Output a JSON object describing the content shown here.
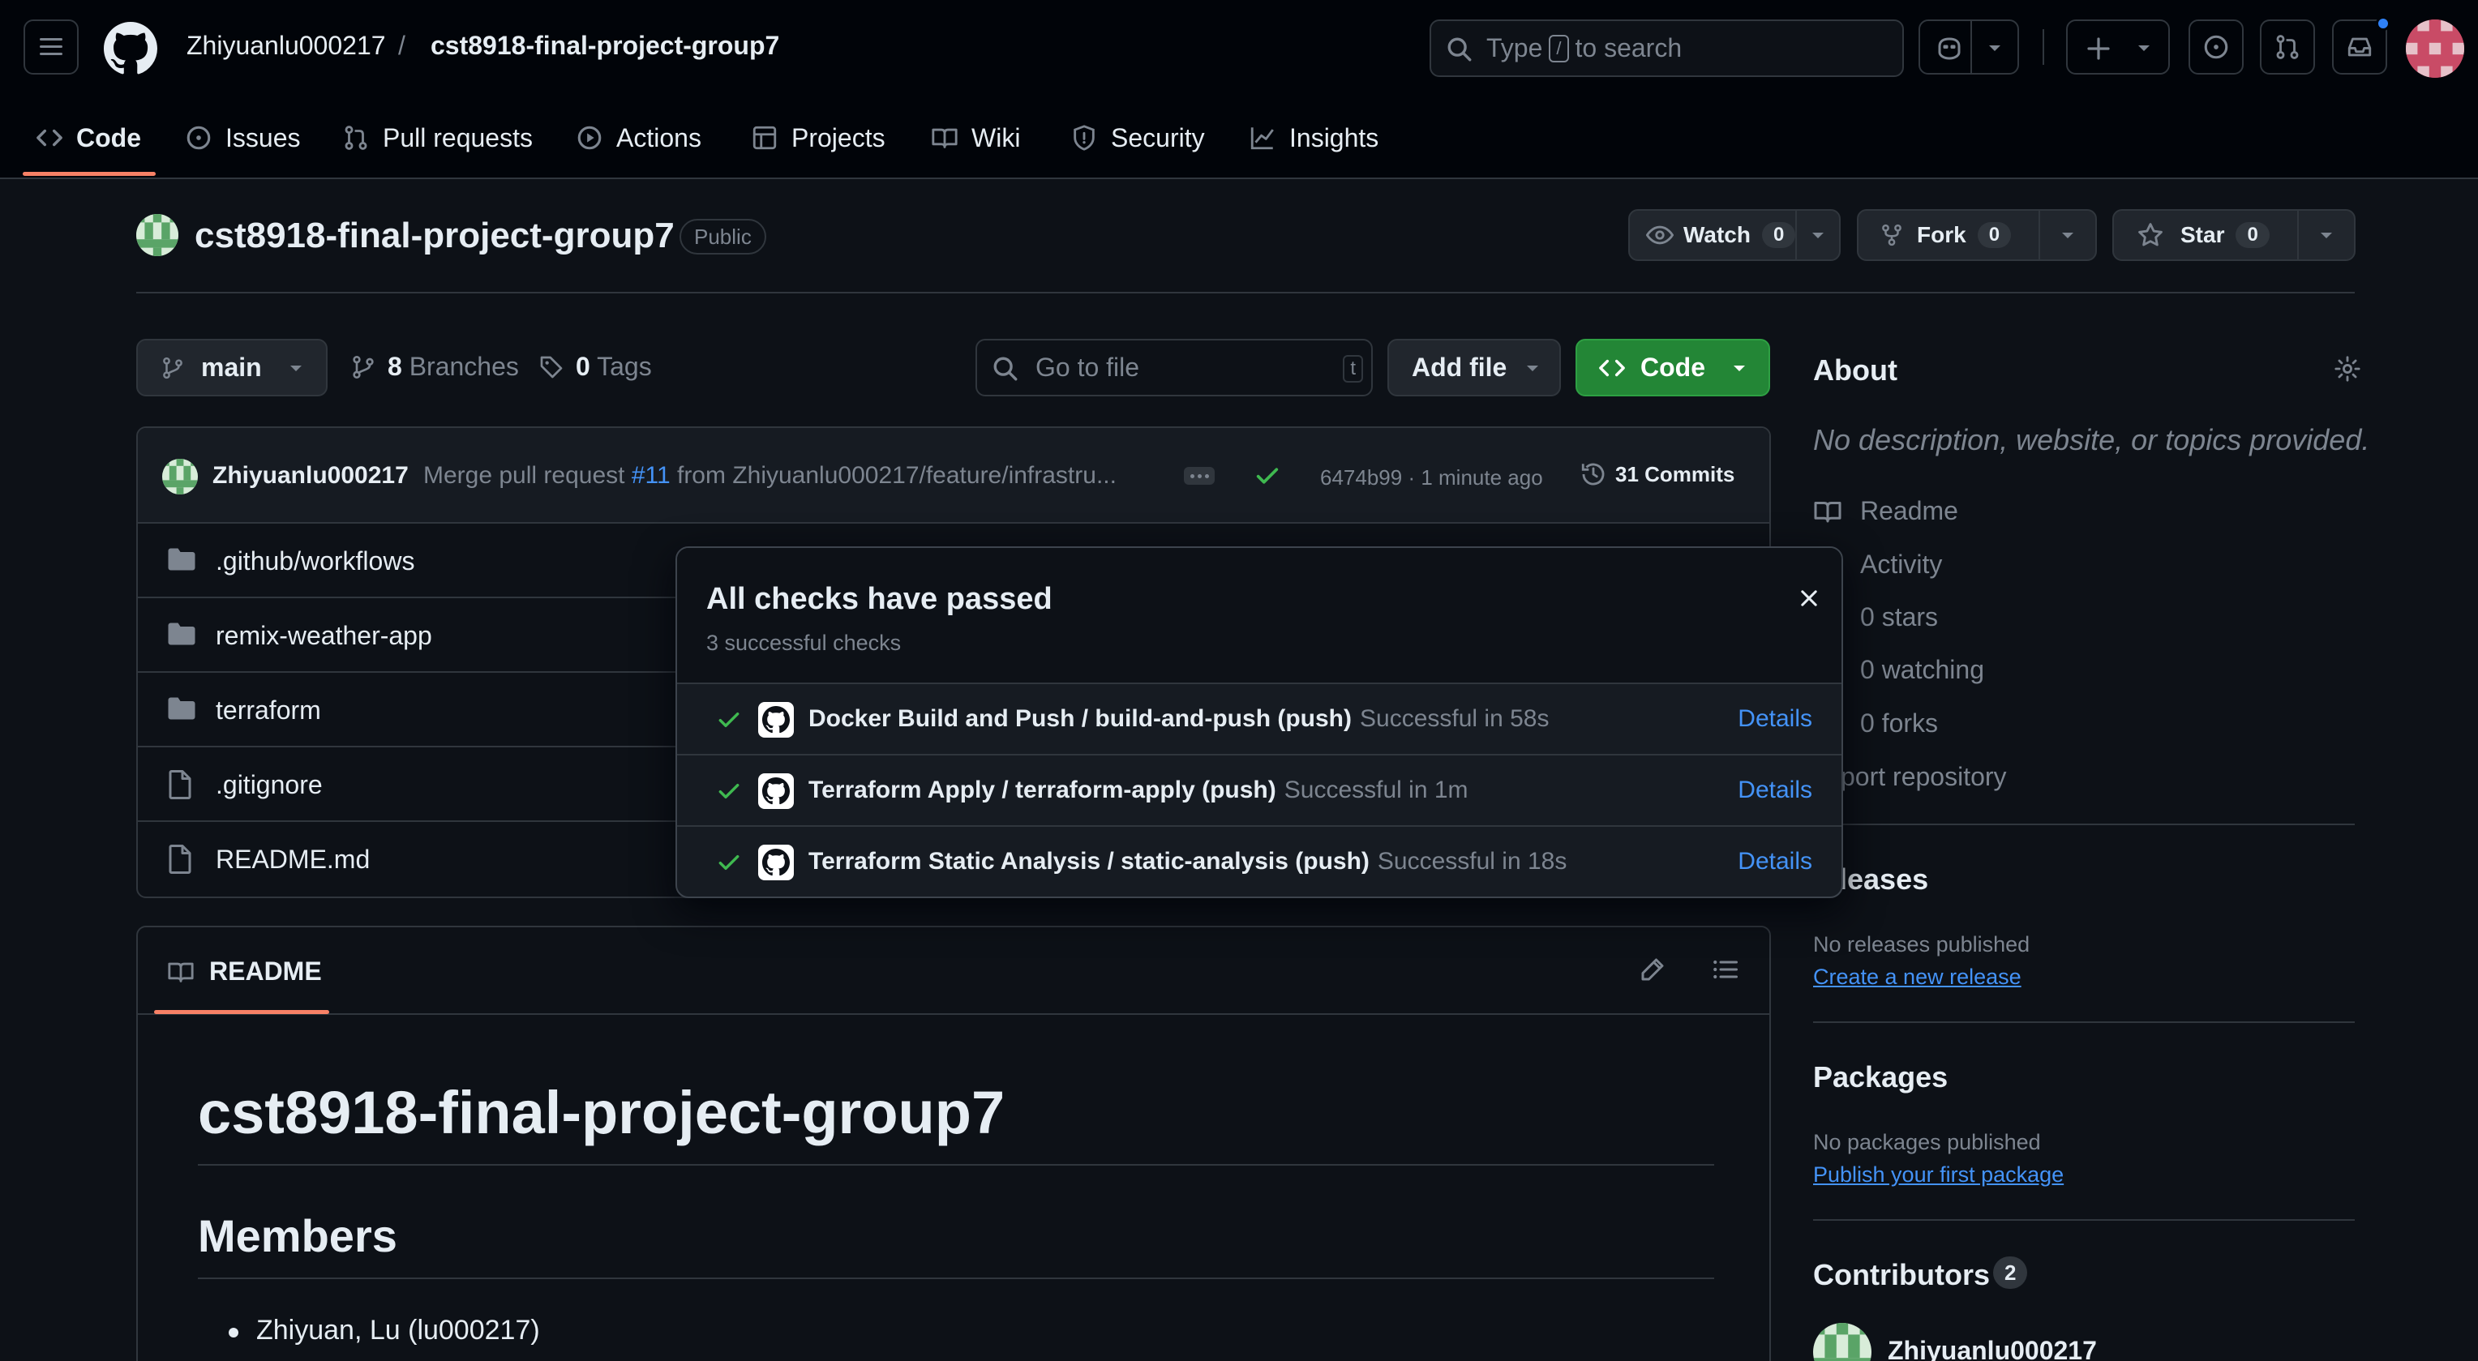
{
  "header": {
    "owner": "Zhiyuanlu000217",
    "separator": "/",
    "repo": "cst8918-final-project-group7",
    "search_prefix": "Type",
    "search_key": "/",
    "search_suffix": "to search"
  },
  "tabs": [
    {
      "label": "Code"
    },
    {
      "label": "Issues"
    },
    {
      "label": "Pull requests"
    },
    {
      "label": "Actions"
    },
    {
      "label": "Projects"
    },
    {
      "label": "Wiki"
    },
    {
      "label": "Security"
    },
    {
      "label": "Insights"
    }
  ],
  "repo": {
    "name": "cst8918-final-project-group7",
    "visibility": "Public",
    "watch_label": "Watch",
    "watch_count": "0",
    "fork_label": "Fork",
    "fork_count": "0",
    "star_label": "Star",
    "star_count": "0"
  },
  "branch_bar": {
    "branch": "main",
    "branches_count": "8",
    "branches_label": "Branches",
    "tags_count": "0",
    "tags_label": "Tags",
    "goto_placeholder": "Go to file",
    "goto_key": "t",
    "add_file": "Add file",
    "code": "Code"
  },
  "commit": {
    "author": "Zhiyuanlu000217",
    "message_prefix": "Merge pull request",
    "pr_ref": "#11",
    "message_suffix": "from Zhiyuanlu000217/feature/infrastru...",
    "hash_time": "6474b99 · 1 minute ago",
    "commits_label": "31 Commits"
  },
  "files": [
    {
      "name": ".github/workflows",
      "type": "folder"
    },
    {
      "name": "remix-weather-app",
      "type": "folder"
    },
    {
      "name": "terraform",
      "type": "folder"
    },
    {
      "name": ".gitignore",
      "type": "file"
    },
    {
      "name": "README.md",
      "type": "file"
    }
  ],
  "readme": {
    "tab": "README",
    "h1": "cst8918-final-project-group7",
    "h2": "Members",
    "member1": "Zhiyuan, Lu (lu000217)"
  },
  "sidebar": {
    "about": "About",
    "description": "No description, website, or topics provided.",
    "readme": "Readme",
    "activity": "Activity",
    "stars": "0 stars",
    "watching": "0 watching",
    "forks": "0 forks",
    "report": "port repository",
    "releases": "leases",
    "no_releases": "No releases published",
    "create_release": "Create a new release",
    "packages": "Packages",
    "no_packages": "No packages published",
    "publish_package": "Publish your first package",
    "contributors": "Contributors",
    "contributors_count": "2",
    "contributor1": "Zhiyuanlu000217"
  },
  "checks": {
    "title": "All checks have passed",
    "subtitle": "3 successful checks",
    "items": [
      {
        "name": "Docker Build and Push / build-and-push (push)",
        "status": "Successful in 58s",
        "details": "Details"
      },
      {
        "name": "Terraform Apply / terraform-apply (push)",
        "status": "Successful in 1m",
        "details": "Details"
      },
      {
        "name": "Terraform Static Analysis / static-analysis (push)",
        "status": "Successful in 18s",
        "details": "Details"
      }
    ]
  },
  "colors": {
    "background": "#0d1117",
    "header_bg": "#010409",
    "accent_link": "#4493f8",
    "success": "#3fb950",
    "primary_button": "#238636",
    "tab_underline": "#f78166"
  }
}
